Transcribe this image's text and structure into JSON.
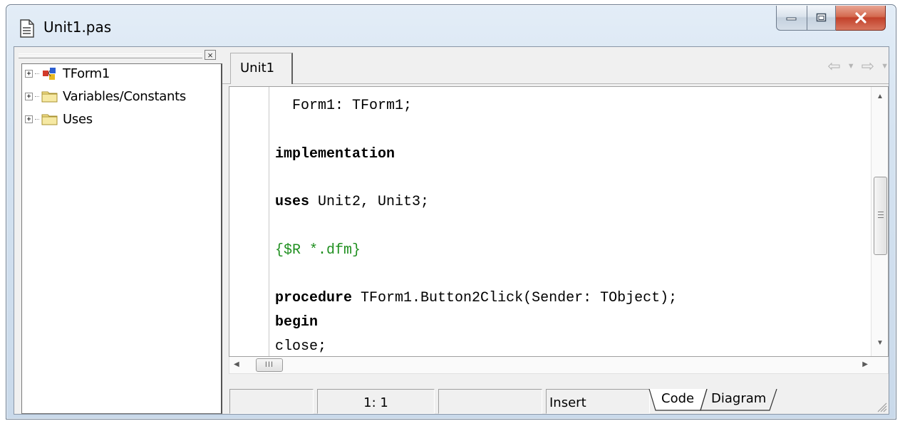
{
  "window": {
    "title": "Unit1.pas"
  },
  "explorer": {
    "close_glyph": "×",
    "items": [
      {
        "label": "TForm1",
        "icon": "form-component-icon"
      },
      {
        "label": "Variables/Constants",
        "icon": "folder-icon"
      },
      {
        "label": "Uses",
        "icon": "folder-icon"
      }
    ]
  },
  "editor": {
    "tabs": [
      {
        "label": "Unit1"
      }
    ],
    "code_lines": [
      {
        "indent": "  ",
        "keyword": "",
        "text": "Form1: TForm1;"
      },
      {
        "indent": "",
        "keyword": "",
        "text": ""
      },
      {
        "indent": "",
        "keyword": "implementation",
        "text": ""
      },
      {
        "indent": "",
        "keyword": "",
        "text": ""
      },
      {
        "indent": "",
        "keyword": "uses",
        "text": " Unit2, Unit3;"
      },
      {
        "indent": "",
        "keyword": "",
        "text": ""
      },
      {
        "indent": "",
        "comment": "{$R *.dfm}"
      },
      {
        "indent": "",
        "keyword": "",
        "text": ""
      },
      {
        "indent": "",
        "keyword": "procedure",
        "text": " TForm1.Button2Click(Sender: TObject);"
      },
      {
        "indent": "",
        "keyword": "begin",
        "text": ""
      },
      {
        "indent": "",
        "keyword": "",
        "text": "close;"
      }
    ]
  },
  "statusbar": {
    "position": "1:  1",
    "mode": "Insert",
    "view_tabs": [
      "Code",
      "Diagram"
    ]
  },
  "colors": {
    "comment": "#1f8f1f",
    "close_button": "#c2412a"
  }
}
